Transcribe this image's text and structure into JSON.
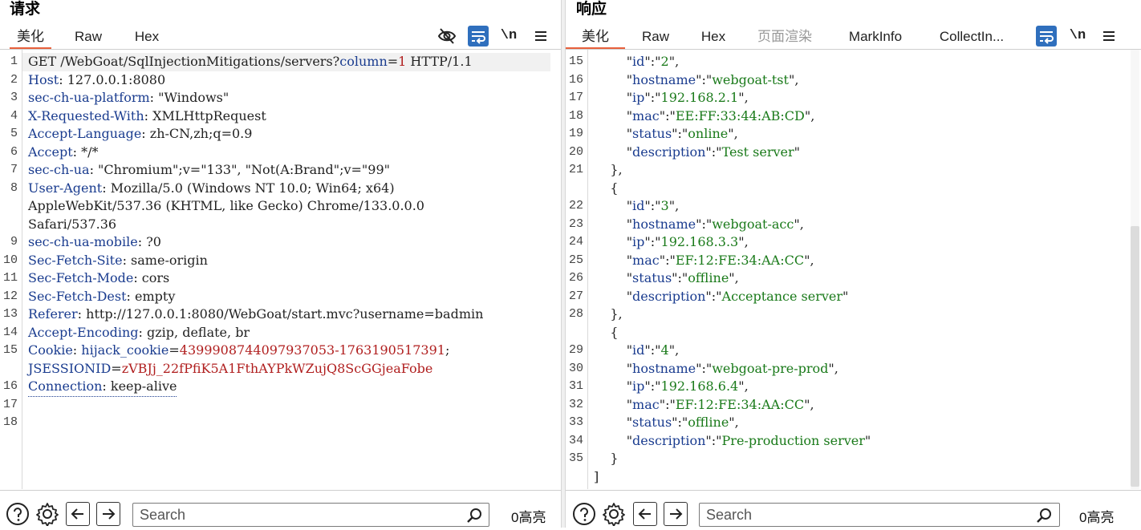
{
  "request": {
    "title": "请求",
    "tabs": [
      "美化",
      "Raw",
      "Hex"
    ],
    "active_tab": "美化",
    "toolbar": {
      "newline_label": "\\n"
    },
    "lines": [
      {
        "n": "1",
        "parts": [
          [
            "t",
            "GET /WebGoat/SqlInjectionMitigations/servers?"
          ],
          [
            "hk",
            "column"
          ],
          [
            "t",
            "="
          ],
          [
            "cv",
            "1"
          ],
          [
            "t",
            " HTTP/1.1"
          ]
        ]
      },
      {
        "n": "2",
        "parts": [
          [
            "hk",
            "Host"
          ],
          [
            "t",
            ": 127.0.0.1:8080"
          ]
        ]
      },
      {
        "n": "3",
        "parts": [
          [
            "hk",
            "sec-ch-ua-platform"
          ],
          [
            "t",
            ": \"Windows\""
          ]
        ]
      },
      {
        "n": "4",
        "parts": [
          [
            "hk",
            "X-Requested-With"
          ],
          [
            "t",
            ": XMLHttpRequest"
          ]
        ]
      },
      {
        "n": "5",
        "parts": [
          [
            "hk",
            "Accept-Language"
          ],
          [
            "t",
            ": zh-CN,zh;q=0.9"
          ]
        ]
      },
      {
        "n": "6",
        "parts": [
          [
            "hk",
            "Accept"
          ],
          [
            "t",
            ": */*"
          ]
        ]
      },
      {
        "n": "7",
        "parts": [
          [
            "hk",
            "sec-ch-ua"
          ],
          [
            "t",
            ": \"Chromium\";v=\"133\", \"Not(A:Brand\";v=\"99\""
          ]
        ]
      },
      {
        "n": "8",
        "parts": [
          [
            "hk",
            "User-Agent"
          ],
          [
            "t",
            ": Mozilla/5.0 (Windows NT 10.0; Win64; x64)"
          ]
        ]
      },
      {
        "n": "",
        "parts": [
          [
            "t",
            "AppleWebKit/537.36 (KHTML, like Gecko) Chrome/133.0.0.0"
          ]
        ]
      },
      {
        "n": "",
        "parts": [
          [
            "t",
            "Safari/537.36"
          ]
        ]
      },
      {
        "n": "9",
        "parts": [
          [
            "hk",
            "sec-ch-ua-mobile"
          ],
          [
            "t",
            ": ?0"
          ]
        ]
      },
      {
        "n": "10",
        "parts": [
          [
            "hk",
            "Sec-Fetch-Site"
          ],
          [
            "t",
            ": same-origin"
          ]
        ]
      },
      {
        "n": "11",
        "parts": [
          [
            "hk",
            "Sec-Fetch-Mode"
          ],
          [
            "t",
            ": cors"
          ]
        ]
      },
      {
        "n": "12",
        "parts": [
          [
            "hk",
            "Sec-Fetch-Dest"
          ],
          [
            "t",
            ": empty"
          ]
        ]
      },
      {
        "n": "13",
        "parts": [
          [
            "hk",
            "Referer"
          ],
          [
            "t",
            ": http://127.0.0.1:8080/WebGoat/start.mvc?username=badmin"
          ]
        ]
      },
      {
        "n": "14",
        "parts": [
          [
            "hk",
            "Accept-Encoding"
          ],
          [
            "t",
            ": gzip, deflate, br"
          ]
        ]
      },
      {
        "n": "15",
        "parts": [
          [
            "hk",
            "Cookie"
          ],
          [
            "t",
            ": "
          ],
          [
            "hk",
            "hijack_cookie"
          ],
          [
            "t",
            "="
          ],
          [
            "cv",
            "4399908744097937053-1763190517391"
          ],
          [
            "t",
            ";"
          ]
        ]
      },
      {
        "n": "",
        "parts": [
          [
            "hk",
            "JSESSIONID"
          ],
          [
            "t",
            "="
          ],
          [
            "cv",
            "zVBJj_22fPfiK5A1FthAYPkWZujQ8ScGGjeaFobe"
          ]
        ]
      },
      {
        "n": "16",
        "parts": [
          [
            "hk",
            "Connection"
          ],
          [
            "t",
            ": keep-alive"
          ]
        ]
      },
      {
        "n": "17",
        "parts": []
      },
      {
        "n": "18",
        "parts": []
      }
    ],
    "footer": {
      "search_placeholder": "Search",
      "highlight_count": "0高亮"
    }
  },
  "response": {
    "title": "响应",
    "tabs": [
      "美化",
      "Raw",
      "Hex",
      "页面渲染",
      "MarkInfo",
      "CollectIn..."
    ],
    "active_tab": "美化",
    "disabled_tab": "页面渲染",
    "toolbar": {
      "newline_label": "\\n"
    },
    "lines": [
      {
        "n": "15",
        "parts": [
          [
            "t",
            "        \""
          ],
          [
            "jk",
            "id"
          ],
          [
            "t",
            "\":\""
          ],
          [
            "js",
            "2"
          ],
          [
            "t",
            "\","
          ]
        ]
      },
      {
        "n": "16",
        "parts": [
          [
            "t",
            "        \""
          ],
          [
            "jk",
            "hostname"
          ],
          [
            "t",
            "\":\""
          ],
          [
            "js",
            "webgoat-tst"
          ],
          [
            "t",
            "\","
          ]
        ]
      },
      {
        "n": "17",
        "parts": [
          [
            "t",
            "        \""
          ],
          [
            "jk",
            "ip"
          ],
          [
            "t",
            "\":\""
          ],
          [
            "js",
            "192.168.2.1"
          ],
          [
            "t",
            "\","
          ]
        ]
      },
      {
        "n": "18",
        "parts": [
          [
            "t",
            "        \""
          ],
          [
            "jk",
            "mac"
          ],
          [
            "t",
            "\":\""
          ],
          [
            "js",
            "EE:FF:33:44:AB:CD"
          ],
          [
            "t",
            "\","
          ]
        ]
      },
      {
        "n": "19",
        "parts": [
          [
            "t",
            "        \""
          ],
          [
            "jk",
            "status"
          ],
          [
            "t",
            "\":\""
          ],
          [
            "js",
            "online"
          ],
          [
            "t",
            "\","
          ]
        ]
      },
      {
        "n": "20",
        "parts": [
          [
            "t",
            "        \""
          ],
          [
            "jk",
            "description"
          ],
          [
            "t",
            "\":\""
          ],
          [
            "js",
            "Test server"
          ],
          [
            "t",
            "\""
          ]
        ]
      },
      {
        "n": "21",
        "parts": [
          [
            "t",
            "    },"
          ]
        ]
      },
      {
        "n": "",
        "parts": [
          [
            "t",
            "    {"
          ]
        ]
      },
      {
        "n": "22",
        "parts": [
          [
            "t",
            "        \""
          ],
          [
            "jk",
            "id"
          ],
          [
            "t",
            "\":\""
          ],
          [
            "js",
            "3"
          ],
          [
            "t",
            "\","
          ]
        ]
      },
      {
        "n": "23",
        "parts": [
          [
            "t",
            "        \""
          ],
          [
            "jk",
            "hostname"
          ],
          [
            "t",
            "\":\""
          ],
          [
            "js",
            "webgoat-acc"
          ],
          [
            "t",
            "\","
          ]
        ]
      },
      {
        "n": "24",
        "parts": [
          [
            "t",
            "        \""
          ],
          [
            "jk",
            "ip"
          ],
          [
            "t",
            "\":\""
          ],
          [
            "js",
            "192.168.3.3"
          ],
          [
            "t",
            "\","
          ]
        ]
      },
      {
        "n": "25",
        "parts": [
          [
            "t",
            "        \""
          ],
          [
            "jk",
            "mac"
          ],
          [
            "t",
            "\":\""
          ],
          [
            "js",
            "EF:12:FE:34:AA:CC"
          ],
          [
            "t",
            "\","
          ]
        ]
      },
      {
        "n": "26",
        "parts": [
          [
            "t",
            "        \""
          ],
          [
            "jk",
            "status"
          ],
          [
            "t",
            "\":\""
          ],
          [
            "js",
            "offline"
          ],
          [
            "t",
            "\","
          ]
        ]
      },
      {
        "n": "27",
        "parts": [
          [
            "t",
            "        \""
          ],
          [
            "jk",
            "description"
          ],
          [
            "t",
            "\":\""
          ],
          [
            "js",
            "Acceptance server"
          ],
          [
            "t",
            "\""
          ]
        ]
      },
      {
        "n": "28",
        "parts": [
          [
            "t",
            "    },"
          ]
        ]
      },
      {
        "n": "",
        "parts": [
          [
            "t",
            "    {"
          ]
        ]
      },
      {
        "n": "29",
        "parts": [
          [
            "t",
            "        \""
          ],
          [
            "jk",
            "id"
          ],
          [
            "t",
            "\":\""
          ],
          [
            "js",
            "4"
          ],
          [
            "t",
            "\","
          ]
        ]
      },
      {
        "n": "30",
        "parts": [
          [
            "t",
            "        \""
          ],
          [
            "jk",
            "hostname"
          ],
          [
            "t",
            "\":\""
          ],
          [
            "js",
            "webgoat-pre-prod"
          ],
          [
            "t",
            "\","
          ]
        ]
      },
      {
        "n": "31",
        "parts": [
          [
            "t",
            "        \""
          ],
          [
            "jk",
            "ip"
          ],
          [
            "t",
            "\":\""
          ],
          [
            "js",
            "192.168.6.4"
          ],
          [
            "t",
            "\","
          ]
        ]
      },
      {
        "n": "32",
        "parts": [
          [
            "t",
            "        \""
          ],
          [
            "jk",
            "mac"
          ],
          [
            "t",
            "\":\""
          ],
          [
            "js",
            "EF:12:FE:34:AA:CC"
          ],
          [
            "t",
            "\","
          ]
        ]
      },
      {
        "n": "33",
        "parts": [
          [
            "t",
            "        \""
          ],
          [
            "jk",
            "status"
          ],
          [
            "t",
            "\":\""
          ],
          [
            "js",
            "offline"
          ],
          [
            "t",
            "\","
          ]
        ]
      },
      {
        "n": "34",
        "parts": [
          [
            "t",
            "        \""
          ],
          [
            "jk",
            "description"
          ],
          [
            "t",
            "\":\""
          ],
          [
            "js",
            "Pre-production server"
          ],
          [
            "t",
            "\""
          ]
        ]
      },
      {
        "n": "35",
        "parts": [
          [
            "t",
            "    }"
          ]
        ]
      },
      {
        "n": "",
        "parts": [
          [
            "t",
            "]"
          ]
        ]
      }
    ],
    "footer": {
      "search_placeholder": "Search",
      "highlight_count": "0高亮"
    }
  },
  "colors": {
    "accent": "#e8603c",
    "toolbar_blue": "#2f6fbd",
    "header_key": "#1a3c8f",
    "cookie_value": "#b01e1e",
    "json_string": "#1a7a1a"
  }
}
